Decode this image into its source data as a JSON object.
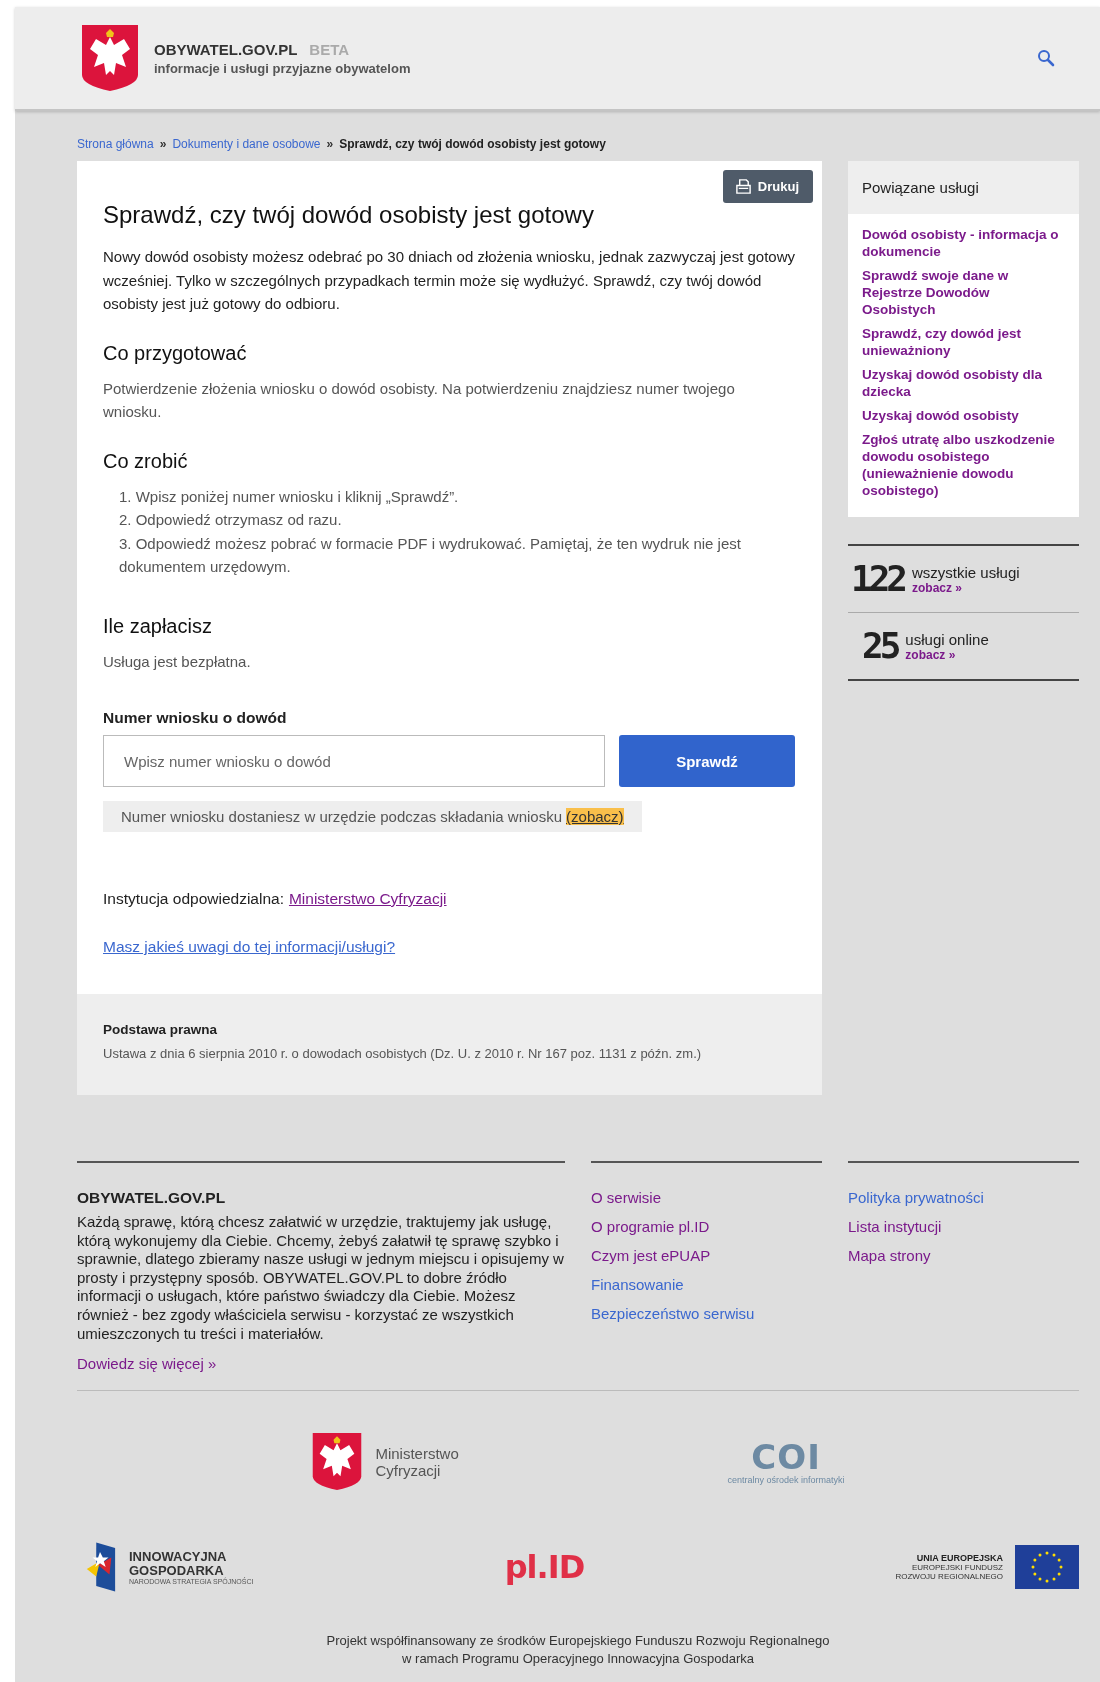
{
  "header": {
    "site_name": "OBYWATEL.GOV.PL",
    "badge": "BETA",
    "tagline": "informacje i usługi przyjazne obywatelom"
  },
  "breadcrumb": [
    {
      "label": "Strona główna",
      "kind": "link",
      "separator": "»"
    },
    {
      "label": "Dokumenty i dane osobowe",
      "kind": "link",
      "separator": "»"
    },
    {
      "label": "Sprawdź, czy twój dowód osobisty jest gotowy",
      "kind": "current"
    }
  ],
  "article": {
    "print_button": "Drukuj",
    "title": "Sprawdź, czy twój dowód osobisty jest gotowy",
    "intro": "Nowy dowód osobisty możesz odebrać po 30 dniach od złożenia wniosku, jednak zazwyczaj jest gotowy wcześniej. Tylko w szczególnych przypadkach termin może się wydłużyć. Sprawdź, czy twój dowód osobisty jest już gotowy do odbioru.",
    "sections": [
      {
        "heading": "Co przygotować",
        "text": "Potwierdzenie złożenia wniosku o dowód osobisty. Na potwierdzeniu znajdziesz numer twojego wniosku."
      },
      {
        "heading": "Co zrobić",
        "steps": [
          {
            "number": "1.",
            "text": "Wpisz poniżej numer wniosku i kliknij „Sprawdź”."
          },
          {
            "number": "2.",
            "text": "Odpowiedź otrzymasz od razu."
          },
          {
            "number": "3.",
            "text": "Odpowiedź możesz pobrać w formacie PDF i wydrukować. Pamiętaj, że ten wydruk nie jest dokumentem urzędowym."
          }
        ]
      },
      {
        "heading": "Ile zapłacisz",
        "text": "Usługa jest bezpłatna."
      }
    ],
    "form": {
      "label": "Numer wniosku o dowód",
      "placeholder": "Wpisz numer wniosku o dowód",
      "button": "Sprawdź",
      "hint": "Numer wniosku dostaniesz w urzędzie podczas składania wniosku",
      "hint_link": "(zobacz)"
    },
    "institution": {
      "label": "Instytucja odpowiedzialna:",
      "link": "Ministerstwo Cyfryzacji",
      "visited": true
    },
    "feedback_link": {
      "label": "Masz jakieś uwagi do tej informacji/usługi?",
      "visited": false
    },
    "legal": {
      "heading": "Podstawa prawna",
      "text": "Ustawa z dnia 6 sierpnia 2010 r. o dowodach osobistych (Dz. U. z 2010 r. Nr 167 poz. 1131 z późn. zm.)"
    }
  },
  "sidebar": {
    "title": "Powiązane usługi",
    "links": [
      {
        "label": "Dowód osobisty - informacja o dokumencie",
        "visited": true
      },
      {
        "label": "Sprawdź swoje dane w Rejestrze Dowodów Osobistych",
        "visited": true
      },
      {
        "label": "Sprawdź, czy dowód jest unieważniony",
        "visited": true
      },
      {
        "label": "Uzyskaj dowód osobisty dla dziecka",
        "visited": true
      },
      {
        "label": "Uzyskaj dowód osobisty",
        "visited": true
      },
      {
        "label": "Zgłoś utratę albo uszkodzenie dowodu osobistego (unieważnienie dowodu osobistego)",
        "visited": true
      }
    ],
    "stats": [
      {
        "number": "122",
        "label": "wszystkie usługi",
        "link": "zobacz »"
      },
      {
        "number": "25",
        "label": "usługi online",
        "link": "zobacz »"
      }
    ]
  },
  "footer": {
    "about": {
      "title": "OBYWATEL.GOV.PL",
      "text": "Każdą sprawę, którą chcesz załatwić w urzędzie, traktujemy jak usługę, którą wykonujemy dla Ciebie. Chcemy, żebyś załatwił tę sprawę szybko i sprawnie, dlatego zbieramy nasze usługi w jednym miejscu i opisujemy w prosty i przystępny sposób. OBYWATEL.GOV.PL to dobre źródło informacji o usługach, które państwo świadczy dla Ciebie. Możesz również - bez zgody właściciela serwisu - korzystać ze wszystkich umieszczonych tu treści i materiałów.",
      "more_link": "Dowiedz się więcej »"
    },
    "links_1": [
      {
        "label": "O serwisie",
        "visited": true
      },
      {
        "label": "O programie pl.ID",
        "visited": true
      },
      {
        "label": "Czym jest ePUAP",
        "visited": true
      },
      {
        "label": "Finansowanie",
        "visited": false
      },
      {
        "label": "Bezpieczeństwo serwisu",
        "visited": false
      }
    ],
    "links_2": [
      {
        "label": "Polityka prywatności",
        "visited": false
      },
      {
        "label": "Lista instytucji",
        "visited": true
      },
      {
        "label": "Mapa strony",
        "visited": true
      }
    ],
    "ministry_logo": {
      "lines": [
        "Ministerstwo",
        "Cyfryzacji"
      ]
    },
    "coi_logo": {
      "mark": "COI",
      "caption": "centralny ośrodek informatyki"
    },
    "ig_logo": {
      "lines": [
        "INNOWACYJNA",
        "GOSPODARKA"
      ],
      "caption": "NARODOWA STRATEGIA SPÓJNOŚCI"
    },
    "plid_logo": {
      "mark": "pl.ID"
    },
    "eu_logo": {
      "title": "UNIA EUROPEJSKA",
      "lines": [
        "EUROPEJSKI FUNDUSZ",
        "ROZWOJU REGIONALNEGO"
      ]
    },
    "note": [
      "Projekt współfinansowany ze środków Europejskiego Funduszu Rozwoju Regionalnego",
      "w ramach Programu Operacyjnego Innowacyjna Gospodarka"
    ]
  }
}
